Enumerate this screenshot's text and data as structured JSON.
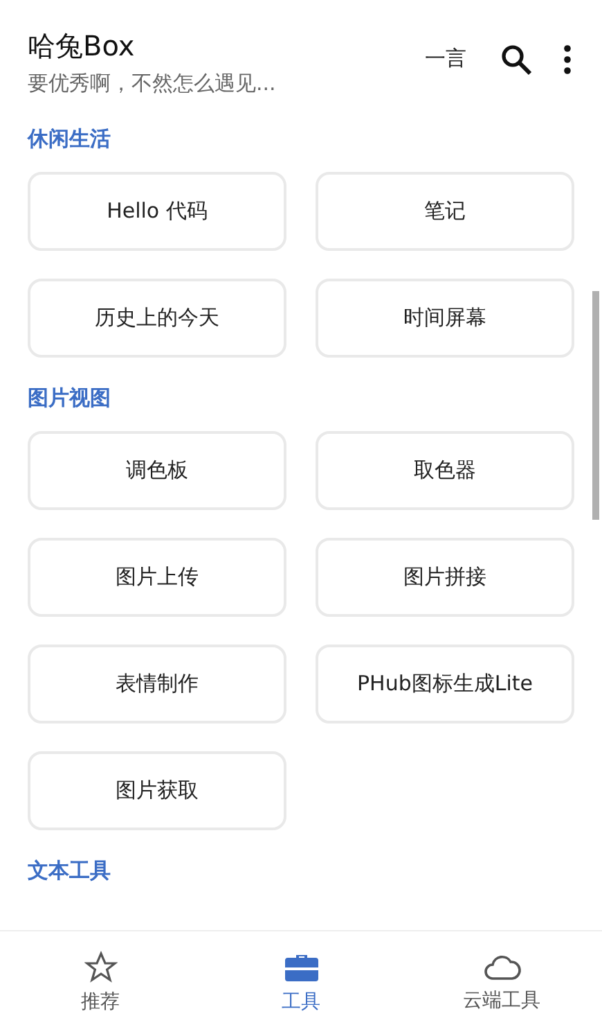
{
  "app_bar": {
    "title": "哈兔Box",
    "subtitle": "要优秀啊，不然怎么遇见...",
    "quote_button": "一言"
  },
  "sections": [
    {
      "title": "休闲生活",
      "tools": [
        "Hello 代码",
        "笔记",
        "历史上的今天",
        "时间屏幕"
      ]
    },
    {
      "title": "图片视图",
      "tools": [
        "调色板",
        "取色器",
        "图片上传",
        "图片拼接",
        "表情制作",
        "PHub图标生成Lite",
        "图片获取"
      ]
    },
    {
      "title": "文本工具"
    }
  ],
  "bottom_nav": [
    {
      "label": "推荐",
      "selected": false
    },
    {
      "label": "工具",
      "selected": true
    },
    {
      "label": "云端工具",
      "selected": false
    }
  ]
}
